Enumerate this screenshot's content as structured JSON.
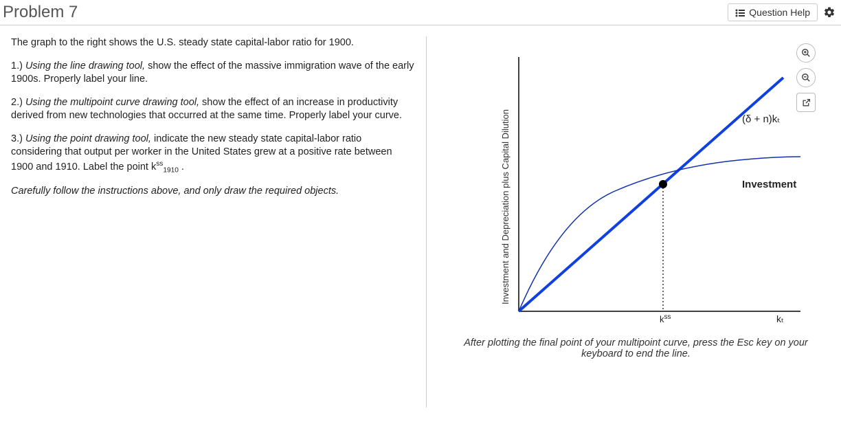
{
  "header": {
    "title": "Problem 7",
    "help_label": "Question Help"
  },
  "instructions": {
    "intro": "The graph to the right shows the U.S. steady state capital-labor ratio for 1900.",
    "q1_prefix": "1.) ",
    "q1_em": "Using the line drawing tool,",
    "q1_rest": " show the effect of the massive immigration wave of the early 1900s. Properly label your line.",
    "q2_prefix": "2.) ",
    "q2_em": "Using the multipoint curve drawing tool,",
    "q2_rest": " show the effect of an increase in productivity derived from new technologies that occurred at the same time. Properly label your curve.",
    "q3_prefix": "3.) ",
    "q3_em": "Using the point drawing tool,",
    "q3_rest_a": " indicate the new steady state capital-labor ratio considering that output per worker in the United States grew at a positive rate between 1900 and 1910.  Label the point k",
    "q3_sup": "ss",
    "q3_sub": "1910",
    "q3_rest_b": " .",
    "footer_em": "Carefully follow the instructions above, and only draw the required objects."
  },
  "graph": {
    "yaxis_label": "Investment and Depreciation plus Capital Dilution",
    "line_label": "(δ + n)kₜ",
    "curve_label": "Investment",
    "xaxis_tick1_base": "k",
    "xaxis_tick1_sup": "ss",
    "xaxis_tick2": "kₜ"
  },
  "hint": "After plotting the final point of your multipoint curve, press the Esc key on your keyboard to end the line.",
  "chart_data": {
    "type": "line",
    "title": "Solow steady state diagram (1900)",
    "xlabel": "kₜ",
    "ylabel": "Investment and Depreciation plus Capital Dilution",
    "series": [
      {
        "name": "(δ + n)kₜ",
        "type": "line",
        "x": [
          0,
          100
        ],
        "y": [
          0,
          100
        ]
      },
      {
        "name": "Investment",
        "type": "curve",
        "x": [
          0,
          10,
          25,
          45,
          70,
          100
        ],
        "y": [
          0,
          26,
          42,
          55,
          63,
          68
        ]
      }
    ],
    "points": [
      {
        "name": "steady state",
        "x": 57,
        "y": 57
      }
    ],
    "xlim": [
      0,
      100
    ],
    "ylim": [
      0,
      100
    ]
  }
}
